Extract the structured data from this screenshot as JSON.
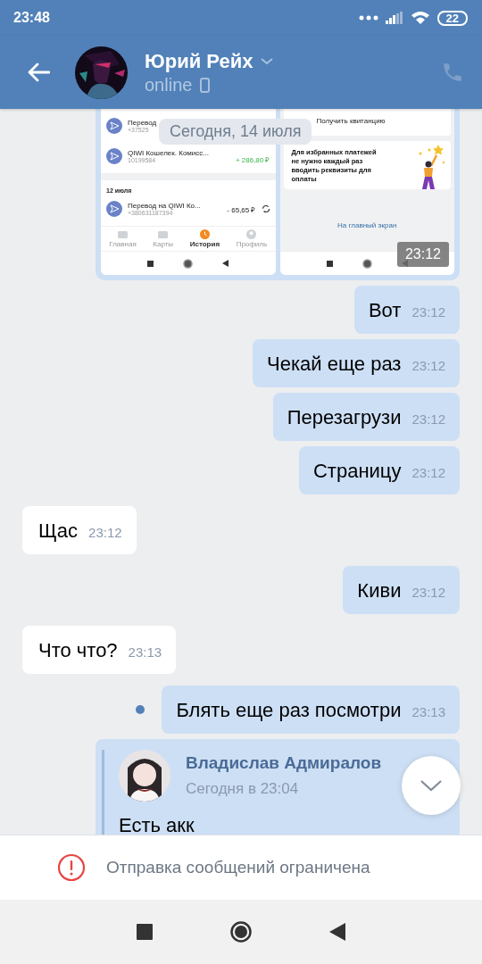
{
  "status_bar": {
    "time": "23:48",
    "battery": "22"
  },
  "header": {
    "name": "Юрий Рейх",
    "status": "online"
  },
  "date_pill": "Сегодня, 14 июля",
  "image_message": {
    "time": "23:12",
    "left_screen": {
      "rows": [
        {
          "title": "Перевод",
          "number": "+37525"
        },
        {
          "title": "QIWI Кошелек. Комисс...",
          "number": "10199584",
          "amount": "+ 286,80 ₽"
        }
      ],
      "section": "12 июля",
      "rows2": [
        {
          "title": "Перевод на QIWI Ко...",
          "number": "+380631187394",
          "amount": "- 65,65 ₽"
        }
      ],
      "tabs": [
        {
          "label": "Главная",
          "selected": false
        },
        {
          "label": "Карты",
          "selected": false
        },
        {
          "label": "История",
          "selected": true
        },
        {
          "label": "Профиль",
          "selected": false
        }
      ]
    },
    "right_screen": {
      "receipt": "Получить квитанцию",
      "promo": "Для избранных платежей не нужно каждый раз вводить реквизиты для оплаты",
      "link": "На главный экран"
    }
  },
  "messages": [
    {
      "kind": "outgoing",
      "text": "Вот",
      "time": "23:12",
      "unread": false
    },
    {
      "kind": "outgoing",
      "text": "Чекай еще раз",
      "time": "23:12",
      "unread": false
    },
    {
      "kind": "outgoing",
      "text": "Перезагрузи",
      "time": "23:12",
      "unread": false
    },
    {
      "kind": "outgoing",
      "text": "Страницу",
      "time": "23:12",
      "unread": false
    },
    {
      "kind": "incoming",
      "text": "Щас",
      "time": "23:12",
      "unread": false
    },
    {
      "kind": "outgoing",
      "text": "Киви",
      "time": "23:12",
      "unread": false
    },
    {
      "kind": "incoming",
      "text": "Что что?",
      "time": "23:13",
      "unread": false
    },
    {
      "kind": "outgoing",
      "text": "Блять еще раз посмотри",
      "time": "23:13",
      "unread": true
    }
  ],
  "forwarded": {
    "author": "Владислав Адмиралов",
    "date": "Сегодня в 23:04",
    "text": "Есть акк"
  },
  "notice": "Отправка сообщений ограничена"
}
